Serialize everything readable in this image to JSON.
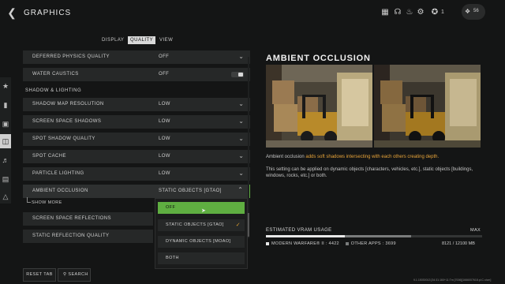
{
  "header": {
    "title": "GRAPHICS",
    "rank_number": "1",
    "player_level": "56",
    "icons": [
      "grid-icon",
      "headset-icon",
      "notifications-icon",
      "settings-icon",
      "rank-badge-icon",
      "player-badge-icon"
    ]
  },
  "tabs": [
    {
      "label": "DISPLAY",
      "active": false
    },
    {
      "label": "QUALITY",
      "active": true
    },
    {
      "label": "VIEW",
      "active": false
    }
  ],
  "sidebar_icons": [
    "star-icon",
    "controller-icon",
    "gamepad-icon",
    "graphics-icon",
    "audio-icon",
    "interface-icon",
    "network-icon"
  ],
  "settings": {
    "deferred_physics": {
      "label": "DEFERRED PHYSICS QUALITY",
      "value": "OFF"
    },
    "water_caustics": {
      "label": "WATER CAUSTICS",
      "value": "OFF"
    },
    "section_title": "SHADOW & LIGHTING",
    "shadow_map": {
      "label": "SHADOW MAP RESOLUTION",
      "value": "LOW"
    },
    "screen_space_shadows": {
      "label": "SCREEN SPACE SHADOWS",
      "value": "LOW"
    },
    "spot_shadow": {
      "label": "SPOT SHADOW QUALITY",
      "value": "LOW"
    },
    "spot_cache": {
      "label": "SPOT CACHE",
      "value": "LOW"
    },
    "particle_lighting": {
      "label": "PARTICLE LIGHTING",
      "value": "LOW"
    },
    "ambient_occlusion": {
      "label": "AMBIENT OCCLUSION",
      "value": "STATIC OBJECTS [GTAO]"
    },
    "show_more": "SHOW MORE",
    "ssr": {
      "label": "SCREEN SPACE REFLECTIONS",
      "value": ""
    },
    "static_reflection": {
      "label": "STATIC REFLECTION QUALITY",
      "value": ""
    }
  },
  "dropdown": {
    "options": [
      "OFF",
      "STATIC OBJECTS [GTAO]",
      "DYNAMIC OBJECTS [MOAO]",
      "BOTH"
    ],
    "hovered": "OFF",
    "selected": "STATIC OBJECTS [GTAO]"
  },
  "buttons": {
    "reset_tab": "RESET TAB",
    "search": "SEARCH"
  },
  "detail": {
    "title": "AMBIENT OCCLUSION",
    "desc_pre": "Ambient occlusion ",
    "desc_highlight": "adds soft shadows intersecting with each others creating depth.",
    "desc2": "This setting can be applied on dynamic objects [characters, vehicles, etc.], static objects [buildings, windows, rocks, etc.] or both."
  },
  "vram": {
    "label": "ESTIMATED VRAM USAGE",
    "max_label": "MAX",
    "mw_label": "MODERN WARFARE® II : 4422",
    "other_label": "OTHER APPS : 3699",
    "total": "8121 / 12100 MB",
    "mw_fraction": 0.365,
    "other_fraction": 0.306
  },
  "build_info": "9.1.15030013 [34:31:160+11:Tm [7006][1666007618.pl.C.x/cm]",
  "colors": {
    "accent_green": "#5fae41",
    "highlight_orange": "#e9a53a",
    "panel": "#262828"
  }
}
